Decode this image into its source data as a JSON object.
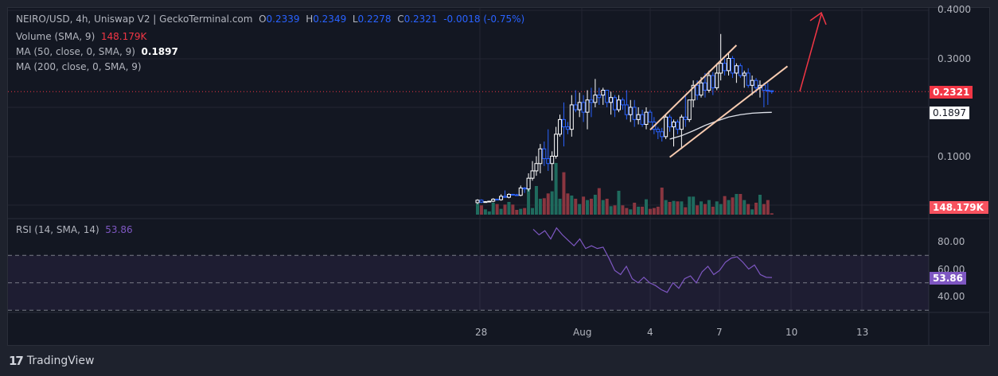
{
  "legend": {
    "symbol": "NEIRO/USD, 4h, Uniswap V2 | GeckoTerminal.com",
    "o_label": "O",
    "o": "0.2339",
    "h_label": "H",
    "h": "0.2349",
    "l_label": "L",
    "l": "0.2278",
    "c_label": "C",
    "c": "0.2321",
    "change": "-0.0018 (-0.75%)",
    "volume_label": "Volume (SMA, 9)",
    "volume_value": "148.179K",
    "ma50_label": "MA (50, close, 0, SMA, 9)",
    "ma50_value": "0.1897",
    "ma200_label": "MA (200, close, 0, SMA, 9)",
    "rsi_label": "RSI (14, SMA, 14)",
    "rsi_value": "53.86"
  },
  "price_axis": [
    "0.4000",
    "0.3000",
    "0.1000"
  ],
  "rsi_axis": [
    "80.00",
    "60.00",
    "40.00"
  ],
  "time_axis": [
    "28",
    "Aug",
    "4",
    "7",
    "10",
    "13"
  ],
  "tags": {
    "last_price": "0.2321",
    "ma50": "0.1897",
    "volume": "148.179K",
    "rsi": "53.86"
  },
  "colors": {
    "up": "#ffffff",
    "down": "#2962ff",
    "vol_up": "#1f6b5e",
    "vol_down": "#8a3640",
    "rsi": "#7e57c2",
    "channel": "#f7cbb0",
    "arrow": "#f23645"
  },
  "brand": "TradingView",
  "chart_data": {
    "type": "candlestick",
    "candles": [
      [
        0.005,
        0.012,
        0.002,
        0.01
      ],
      [
        0.01,
        0.012,
        0.004,
        0.006
      ],
      [
        0.006,
        0.008,
        0.005,
        0.007
      ],
      [
        0.007,
        0.009,
        0.006,
        0.008
      ],
      [
        0.008,
        0.014,
        0.006,
        0.012
      ],
      [
        0.012,
        0.013,
        0.01,
        0.011
      ],
      [
        0.011,
        0.022,
        0.009,
        0.018
      ],
      [
        0.018,
        0.03,
        0.015,
        0.016
      ],
      [
        0.016,
        0.024,
        0.014,
        0.022
      ],
      [
        0.022,
        0.023,
        0.02,
        0.021
      ],
      [
        0.021,
        0.023,
        0.019,
        0.02
      ],
      [
        0.02,
        0.04,
        0.018,
        0.035
      ],
      [
        0.035,
        0.037,
        0.025,
        0.033
      ],
      [
        0.033,
        0.065,
        0.028,
        0.055
      ],
      [
        0.055,
        0.09,
        0.05,
        0.07
      ],
      [
        0.07,
        0.1,
        0.06,
        0.085
      ],
      [
        0.085,
        0.125,
        0.065,
        0.115
      ],
      [
        0.115,
        0.13,
        0.08,
        0.095
      ],
      [
        0.095,
        0.155,
        0.07,
        0.085
      ],
      [
        0.085,
        0.11,
        0.05,
        0.1
      ],
      [
        0.1,
        0.16,
        0.095,
        0.145
      ],
      [
        0.145,
        0.185,
        0.14,
        0.175
      ],
      [
        0.175,
        0.21,
        0.12,
        0.16
      ],
      [
        0.16,
        0.17,
        0.145,
        0.155
      ],
      [
        0.155,
        0.225,
        0.14,
        0.205
      ],
      [
        0.205,
        0.235,
        0.19,
        0.195
      ],
      [
        0.195,
        0.23,
        0.18,
        0.21
      ],
      [
        0.21,
        0.225,
        0.17,
        0.19
      ],
      [
        0.19,
        0.235,
        0.155,
        0.215
      ],
      [
        0.215,
        0.24,
        0.18,
        0.21
      ],
      [
        0.21,
        0.258,
        0.2,
        0.225
      ],
      [
        0.225,
        0.24,
        0.205,
        0.22
      ],
      [
        0.225,
        0.24,
        0.205,
        0.235
      ],
      [
        0.235,
        0.235,
        0.2,
        0.21
      ],
      [
        0.21,
        0.232,
        0.185,
        0.22
      ],
      [
        0.22,
        0.225,
        0.18,
        0.195
      ],
      [
        0.195,
        0.225,
        0.19,
        0.215
      ],
      [
        0.215,
        0.22,
        0.195,
        0.205
      ],
      [
        0.205,
        0.235,
        0.175,
        0.185
      ],
      [
        0.185,
        0.215,
        0.17,
        0.2
      ],
      [
        0.2,
        0.215,
        0.16,
        0.175
      ],
      [
        0.175,
        0.2,
        0.165,
        0.185
      ],
      [
        0.185,
        0.195,
        0.16,
        0.165
      ],
      [
        0.165,
        0.2,
        0.155,
        0.19
      ],
      [
        0.19,
        0.195,
        0.175,
        0.17
      ],
      [
        0.17,
        0.18,
        0.145,
        0.155
      ],
      [
        0.155,
        0.16,
        0.135,
        0.15
      ],
      [
        0.15,
        0.158,
        0.13,
        0.14
      ],
      [
        0.14,
        0.185,
        0.135,
        0.18
      ],
      [
        0.18,
        0.185,
        0.15,
        0.16
      ],
      [
        0.16,
        0.175,
        0.12,
        0.17
      ],
      [
        0.17,
        0.175,
        0.145,
        0.155
      ],
      [
        0.155,
        0.185,
        0.115,
        0.18
      ],
      [
        0.18,
        0.225,
        0.16,
        0.175
      ],
      [
        0.175,
        0.215,
        0.17,
        0.215
      ],
      [
        0.215,
        0.255,
        0.2,
        0.245
      ],
      [
        0.245,
        0.255,
        0.215,
        0.225
      ],
      [
        0.225,
        0.262,
        0.22,
        0.25
      ],
      [
        0.25,
        0.27,
        0.22,
        0.235
      ],
      [
        0.235,
        0.275,
        0.23,
        0.265
      ],
      [
        0.265,
        0.272,
        0.225,
        0.24
      ],
      [
        0.24,
        0.29,
        0.235,
        0.27
      ],
      [
        0.27,
        0.35,
        0.255,
        0.29
      ],
      [
        0.29,
        0.3,
        0.265,
        0.275
      ],
      [
        0.275,
        0.31,
        0.265,
        0.3
      ],
      [
        0.3,
        0.305,
        0.26,
        0.27
      ],
      [
        0.27,
        0.29,
        0.25,
        0.285
      ],
      [
        0.285,
        0.29,
        0.26,
        0.265
      ],
      [
        0.265,
        0.275,
        0.24,
        0.27
      ],
      [
        0.27,
        0.28,
        0.24,
        0.245
      ],
      [
        0.245,
        0.265,
        0.225,
        0.255
      ],
      [
        0.255,
        0.26,
        0.23,
        0.24
      ],
      [
        0.24,
        0.255,
        0.22,
        0.245
      ],
      [
        0.245,
        0.25,
        0.2,
        0.235
      ],
      [
        0.235,
        0.25,
        0.205,
        0.2339
      ],
      [
        0.2339,
        0.2349,
        0.2278,
        0.2321
      ]
    ],
    "volume_k": [
      1218,
      1015,
      580,
      348,
      1305,
      1160,
      638,
      1102,
      1392,
      1102,
      522,
      638,
      725,
      2900,
      725,
      3132,
      1740,
      1798,
      2320,
      2552,
      5655,
      1740,
      4640,
      2320,
      2088,
      1740,
      1160,
      1972,
      1595,
      1740,
      2175,
      2900,
      1595,
      1740,
      928,
      1015,
      2610,
      1015,
      725,
      580,
      1305,
      870,
      870,
      1682,
      638,
      725,
      870,
      2958,
      1595,
      1392,
      1508,
      1450,
      1450,
      812,
      1972,
      1972,
      1015,
      1450,
      1160,
      1595,
      870,
      1450,
      1160,
      2030,
      1595,
      1885,
      2262,
      2262,
      1595,
      1160,
      580,
      1305,
      2175,
      1160,
      1595,
      148.179
    ],
    "ma50": [
      [
        49,
        0.135
      ],
      [
        52,
        0.142
      ],
      [
        55,
        0.152
      ],
      [
        58,
        0.163
      ],
      [
        61,
        0.172
      ],
      [
        64,
        0.18
      ],
      [
        67,
        0.185
      ],
      [
        70,
        0.188
      ],
      [
        73,
        0.1893
      ],
      [
        75,
        0.1897
      ]
    ],
    "rsi": [
      89,
      85,
      88,
      82,
      90,
      85,
      81,
      77,
      82,
      75,
      77,
      75,
      76,
      68,
      59,
      56,
      62,
      53,
      50,
      54,
      50,
      48,
      45,
      43,
      50,
      46,
      53,
      55,
      50,
      58,
      62,
      56,
      59,
      65,
      68,
      69,
      65,
      60,
      63,
      56,
      54,
      53.86
    ],
    "price_range": [
      0,
      0.4
    ],
    "rsi_range": [
      30,
      90
    ]
  }
}
